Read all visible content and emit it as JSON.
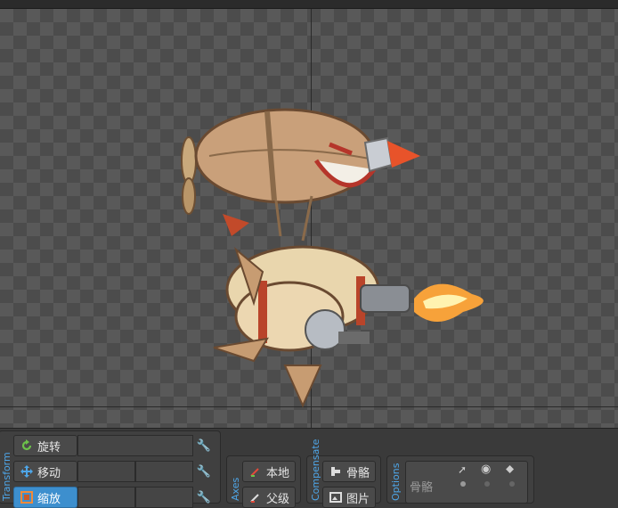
{
  "transform_panel": {
    "section_label": "Transform",
    "rotate_label": "旋转",
    "translate_label": "移动",
    "scale_label": "缩放"
  },
  "axes_panel": {
    "section_label": "Axes",
    "local_label": "本地",
    "parent_label": "父级"
  },
  "compensate_panel": {
    "section_label": "Compensate",
    "bones_label": "骨骼",
    "images_label": "图片"
  },
  "options_panel": {
    "section_label": "Options",
    "bones_row_label": "骨骼"
  }
}
